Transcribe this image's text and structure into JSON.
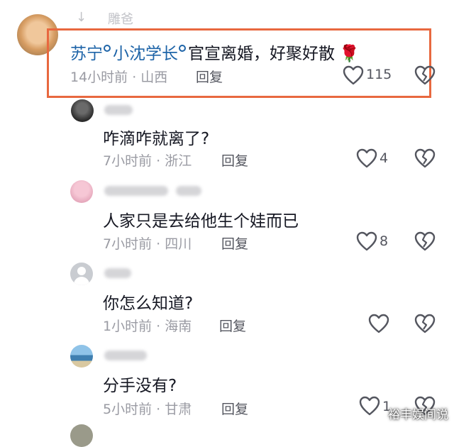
{
  "header_partial": {
    "name": "雕爸",
    "cut_text": "↓"
  },
  "comments": [
    {
      "mention1": "苏宁",
      "mention2": "小沈学长",
      "text": "官宣离婚，好聚好散",
      "emoji": "🌹",
      "time_location": "14小时前 · 山西",
      "reply_label": "回复",
      "likes": "115"
    },
    {
      "text": "咋滴咋就离了?",
      "time_location": "7小时前 · 浙江",
      "reply_label": "回复",
      "likes": "4"
    },
    {
      "text": "人家只是去给他生个娃而已",
      "time_location": "7小时前 · 四川",
      "reply_label": "回复",
      "likes": "8"
    },
    {
      "text": "你怎么知道?",
      "time_location": "1小时前 · 海南",
      "reply_label": "回复",
      "likes": ""
    },
    {
      "text": "分手没有?",
      "time_location": "5小时前 · 甘肃",
      "reply_label": "回复",
      "likes": "1"
    }
  ],
  "watermark": "裕丰娱间说",
  "colors": {
    "highlight": "#e8683f",
    "mention": "#1e64a8",
    "meta": "#9a9ba3"
  }
}
